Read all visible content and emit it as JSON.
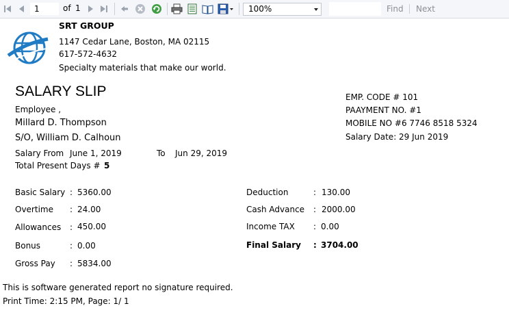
{
  "toolbar": {
    "page_current": "1",
    "page_of_label": "of",
    "page_total": "1",
    "zoom_value": "100%",
    "find_label": "Find",
    "next_label": "Next",
    "icons": [
      "first-page-icon",
      "prev-page-icon",
      "next-page-icon",
      "last-page-icon",
      "back-icon",
      "stop-icon",
      "refresh-icon",
      "print-icon",
      "print-layout-icon",
      "page-setup-icon",
      "export-icon"
    ]
  },
  "company": {
    "name": "SRT GROUP",
    "address": "1147 Cedar Lane, Boston, MA 02115",
    "phone": "617-572-4632",
    "tagline": "Specialty materials that make our world."
  },
  "slip": {
    "title": "SALARY SLIP",
    "employee_label": "Employee ,",
    "employee_name": "Millard D. Thompson",
    "relation": "S/O, William D. Calhoun",
    "salary_from_label": "Salary From",
    "salary_from": "June 1, 2019",
    "to_label": "To",
    "salary_to": "Jun 29, 2019",
    "present_days_label": "Total Present Days #",
    "present_days": "5"
  },
  "meta": {
    "emp_code": "EMP. CODE # 101",
    "payment_no": "PAAYMENT NO. #1",
    "mobile": "MOBILE NO #6 7746 8518 5324",
    "salary_date": "Salary Date: 29 Jun 2019"
  },
  "earnings": [
    {
      "label": "Basic Salary",
      "value": "5360.00"
    },
    {
      "label": "Overtime",
      "value": "24.00"
    },
    {
      "label": "Allowances",
      "value": "450.00"
    },
    {
      "label": "Bonus",
      "value": "0.00"
    },
    {
      "label": "Gross Pay",
      "value": "5834.00"
    }
  ],
  "deductions": [
    {
      "label": "Deduction",
      "value": "130.00"
    },
    {
      "label": "Cash Advance",
      "value": "2000.00"
    },
    {
      "label": "Income TAX",
      "value": "0.00"
    },
    {
      "label": "Final Salary",
      "value": "3704.00"
    }
  ],
  "colon": ":",
  "footer": {
    "note": "This is software generated report no signature required.",
    "print_time": "Print Time: 2:15 PM, Page: 1/ 1"
  },
  "colors": {
    "toolbar_bg": "#f4f6f9",
    "logo_blue": "#1e7bc4"
  }
}
